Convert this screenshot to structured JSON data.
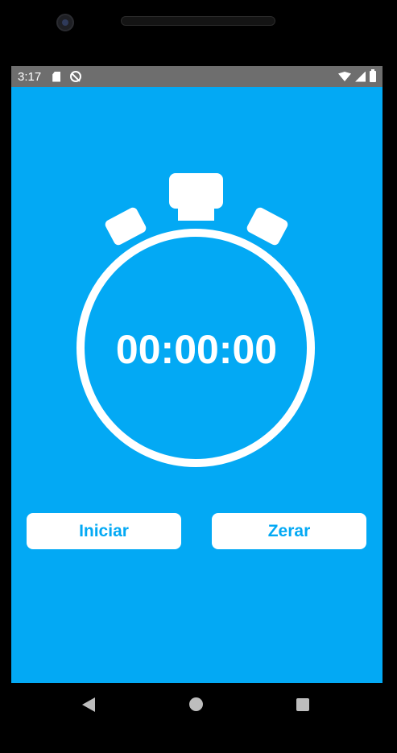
{
  "status_bar": {
    "time": "3:17",
    "left_icons": [
      "sd-card-icon",
      "sync-icon"
    ],
    "right_icons": [
      "wifi-icon",
      "signal-icon",
      "battery-icon"
    ]
  },
  "stopwatch": {
    "display": "00:00:00",
    "icon": "stopwatch-icon"
  },
  "buttons": {
    "start_label": "Iniciar",
    "reset_label": "Zerar"
  },
  "nav_bar": {
    "icons": [
      "back-icon",
      "home-icon",
      "recents-icon"
    ]
  },
  "colors": {
    "background": "#03A9F4",
    "status_bar": "#6E6E6E",
    "button_bg": "#FFFFFF",
    "button_text": "#03A9F4",
    "foreground": "#FFFFFF"
  }
}
